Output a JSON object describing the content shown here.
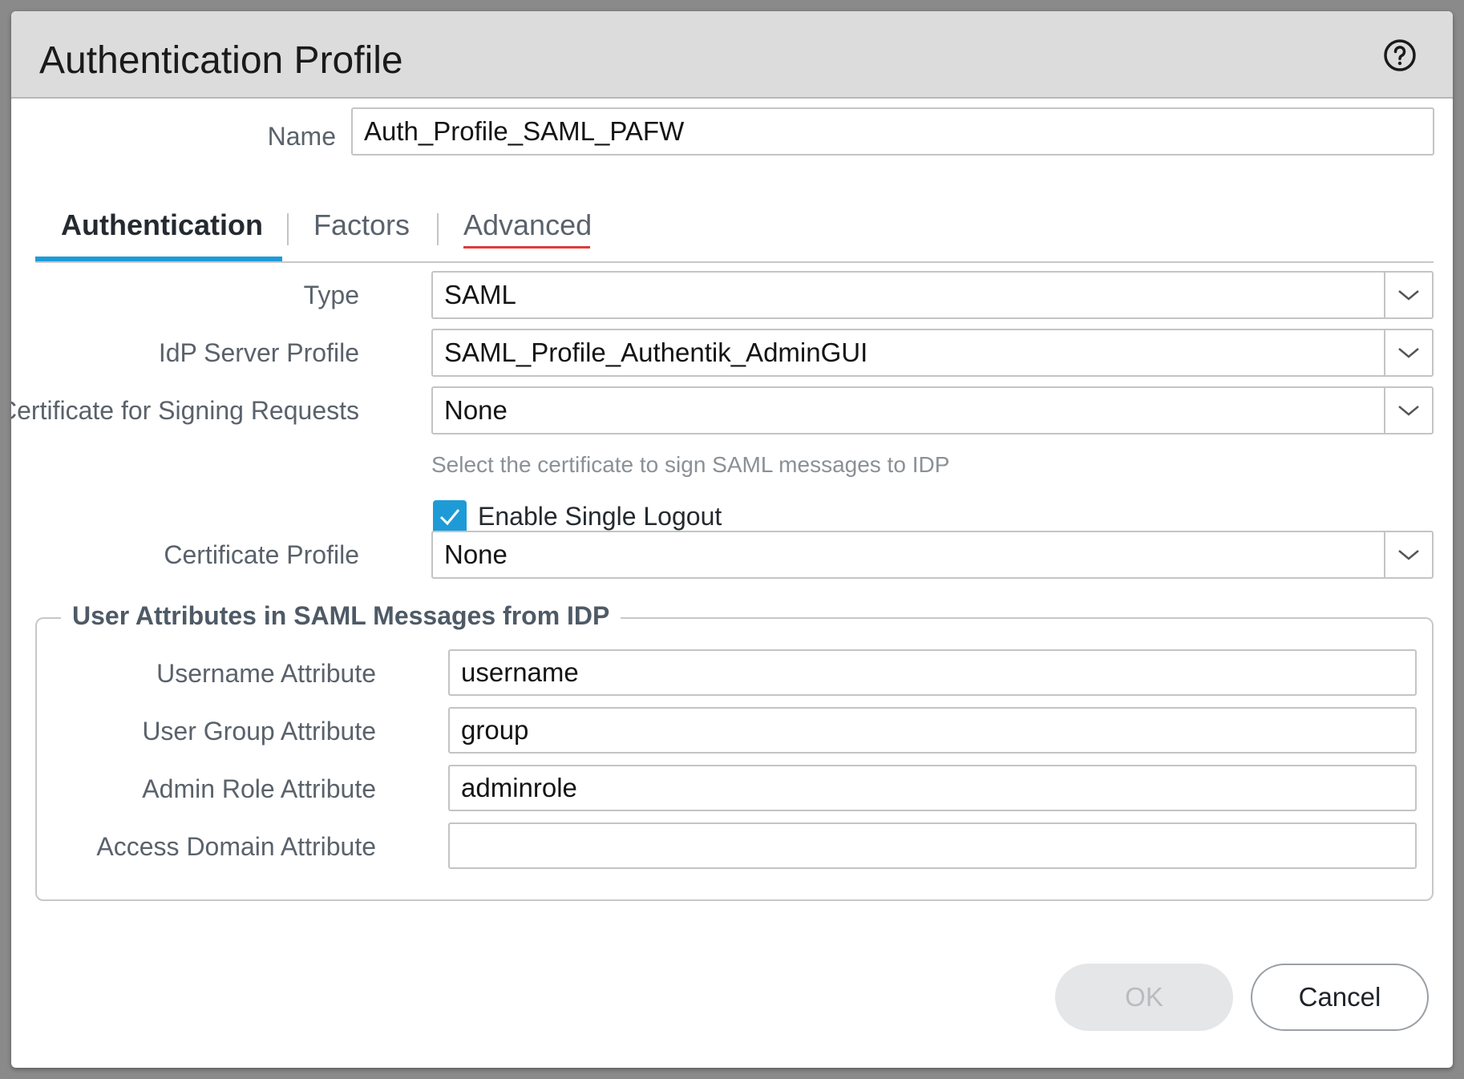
{
  "dialog": {
    "title": "Authentication Profile"
  },
  "name_field": {
    "label": "Name",
    "value": "Auth_Profile_SAML_PAFW"
  },
  "tabs": [
    {
      "label": "Authentication",
      "active": true
    },
    {
      "label": "Factors",
      "active": false
    },
    {
      "label": "Advanced",
      "active": false
    }
  ],
  "authentication": {
    "type": {
      "label": "Type",
      "value": "SAML"
    },
    "idp_server_profile": {
      "label": "IdP Server Profile",
      "value": "SAML_Profile_Authentik_AdminGUI"
    },
    "cert_signing": {
      "label": "Certificate for Signing Requests",
      "value": "None",
      "hint": "Select the certificate to sign SAML messages to IDP"
    },
    "single_logout": {
      "label": "Enable Single Logout",
      "checked": true
    },
    "cert_profile": {
      "label": "Certificate Profile",
      "value": "None"
    }
  },
  "user_attributes": {
    "legend": "User Attributes in SAML Messages from IDP",
    "username": {
      "label": "Username Attribute",
      "value": "username"
    },
    "user_group": {
      "label": "User Group Attribute",
      "value": "group"
    },
    "admin_role": {
      "label": "Admin Role Attribute",
      "value": "adminrole"
    },
    "access_domain": {
      "label": "Access Domain Attribute",
      "value": ""
    }
  },
  "buttons": {
    "ok": "OK",
    "cancel": "Cancel"
  },
  "colors": {
    "accent": "#1e9bd7",
    "tab_underline": "#1e9bd7",
    "spellcheck_underline": "#e03a3a",
    "title_bar": "#dcdcdc"
  }
}
